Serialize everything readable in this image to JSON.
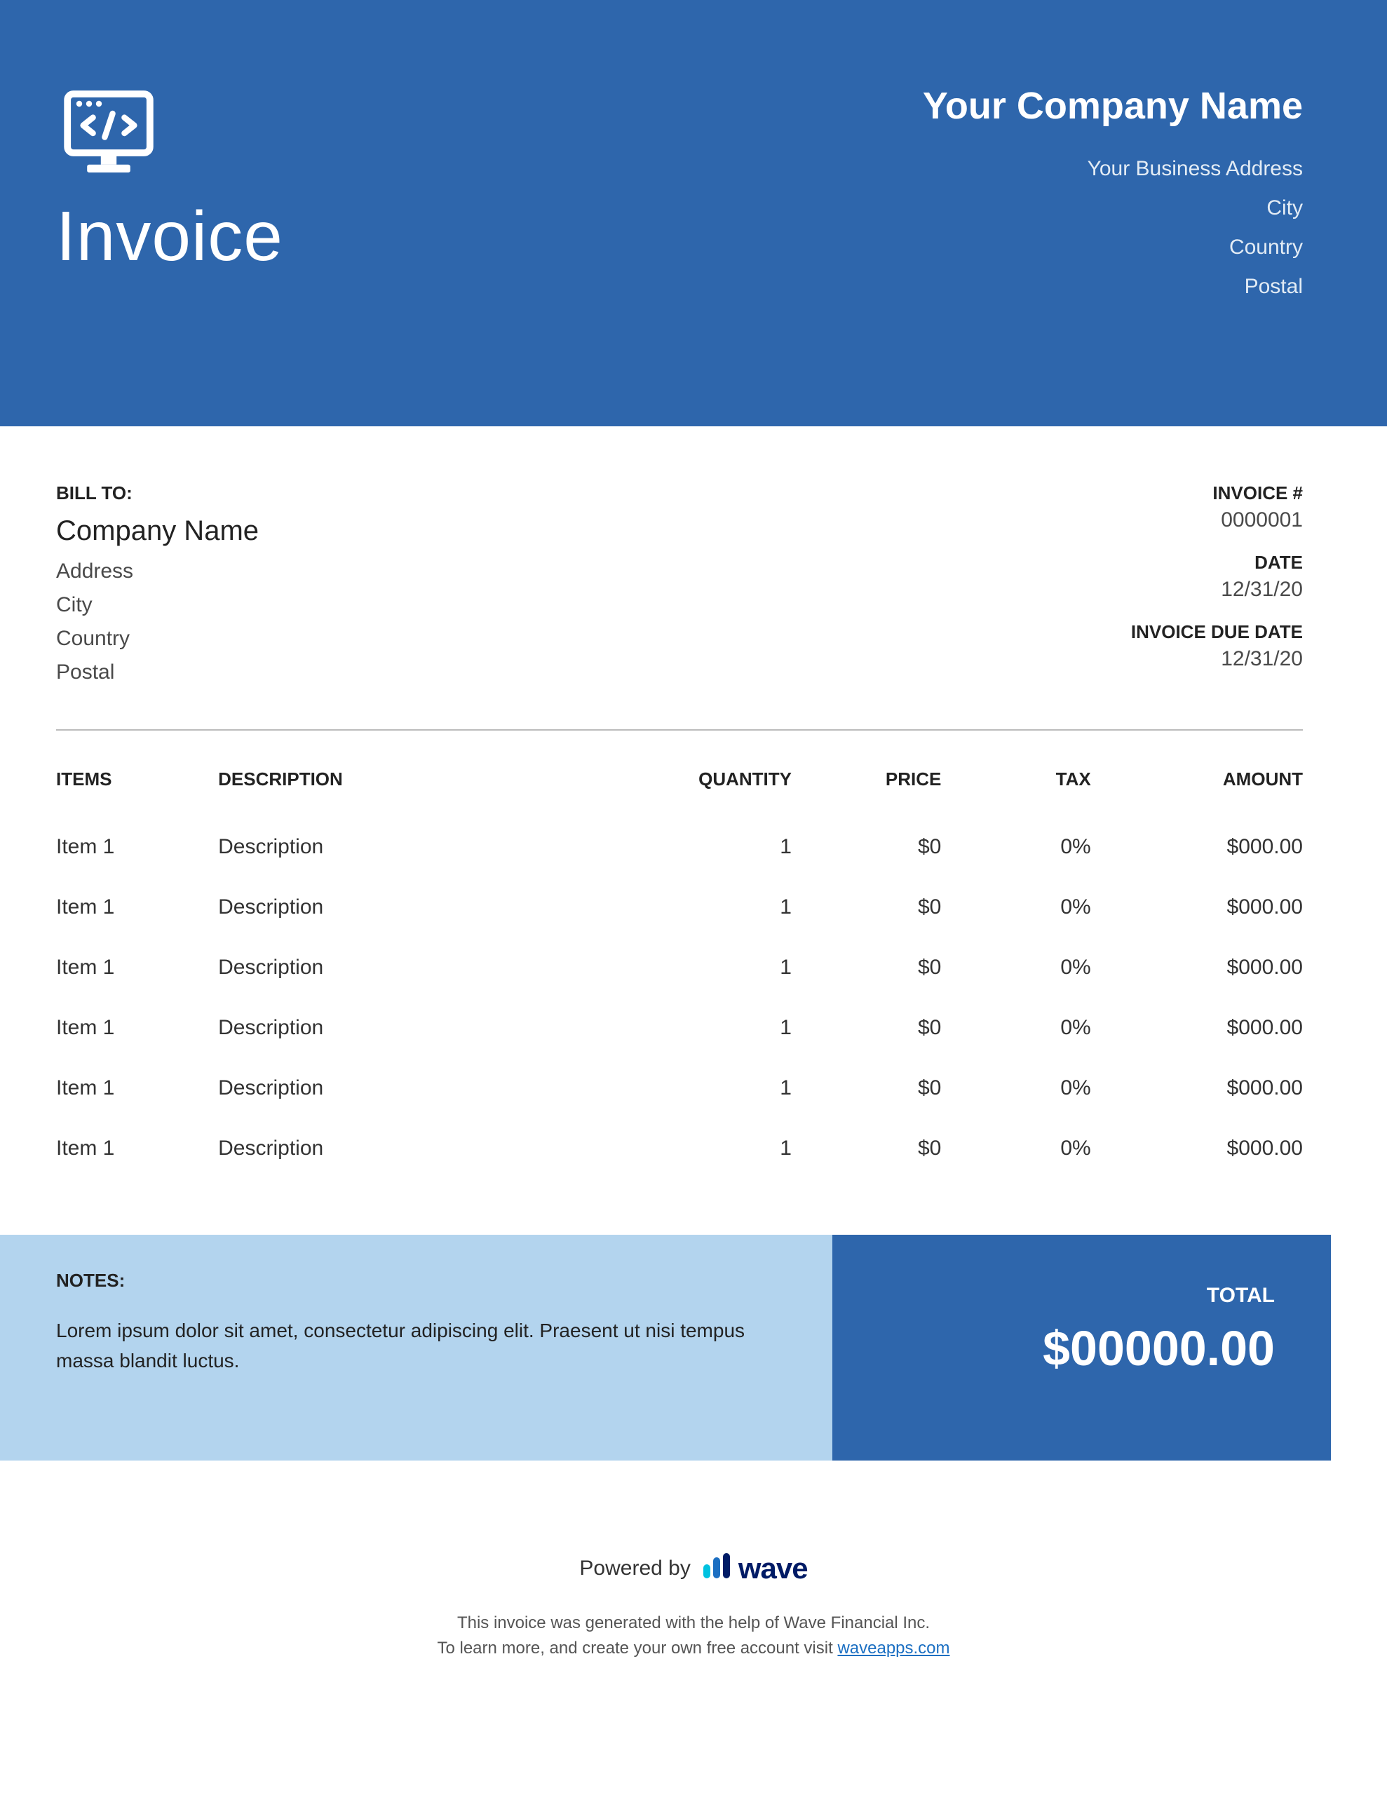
{
  "header": {
    "title": "Invoice",
    "company_name": "Your Company Name",
    "address": "Your Business Address",
    "city": "City",
    "country": "Country",
    "postal": "Postal"
  },
  "bill_to": {
    "label": "BILL TO:",
    "company": "Company Name",
    "address": "Address",
    "city": "City",
    "country": "Country",
    "postal": "Postal"
  },
  "meta": {
    "invoice_no_label": "INVOICE #",
    "invoice_no": "0000001",
    "date_label": "DATE",
    "date": "12/31/20",
    "due_label": "INVOICE DUE DATE",
    "due": "12/31/20"
  },
  "table": {
    "headers": {
      "items": "ITEMS",
      "description": "DESCRIPTION",
      "quantity": "QUANTITY",
      "price": "PRICE",
      "tax": "TAX",
      "amount": "AMOUNT"
    },
    "rows": [
      {
        "item": "Item 1",
        "description": "Description",
        "quantity": "1",
        "price": "$0",
        "tax": "0%",
        "amount": "$000.00"
      },
      {
        "item": "Item 1",
        "description": "Description",
        "quantity": "1",
        "price": "$0",
        "tax": "0%",
        "amount": "$000.00"
      },
      {
        "item": "Item 1",
        "description": "Description",
        "quantity": "1",
        "price": "$0",
        "tax": "0%",
        "amount": "$000.00"
      },
      {
        "item": "Item 1",
        "description": "Description",
        "quantity": "1",
        "price": "$0",
        "tax": "0%",
        "amount": "$000.00"
      },
      {
        "item": "Item 1",
        "description": "Description",
        "quantity": "1",
        "price": "$0",
        "tax": "0%",
        "amount": "$000.00"
      },
      {
        "item": "Item 1",
        "description": "Description",
        "quantity": "1",
        "price": "$0",
        "tax": "0%",
        "amount": "$000.00"
      }
    ]
  },
  "notes": {
    "label": "NOTES:",
    "body": "Lorem ipsum dolor sit amet, consectetur adipiscing elit. Praesent ut nisi tempus massa blandit luctus."
  },
  "total": {
    "label": "TOTAL",
    "value": "$00000.00"
  },
  "powered": {
    "by": "Powered by",
    "brand": "wave",
    "desc1": "This invoice was generated with the help of Wave Financial Inc.",
    "desc2_prefix": "To learn more, and create your own free account visit ",
    "link_text": "waveapps.com"
  },
  "colors": {
    "primary": "#2e66ac",
    "light": "#b3d4ee"
  }
}
